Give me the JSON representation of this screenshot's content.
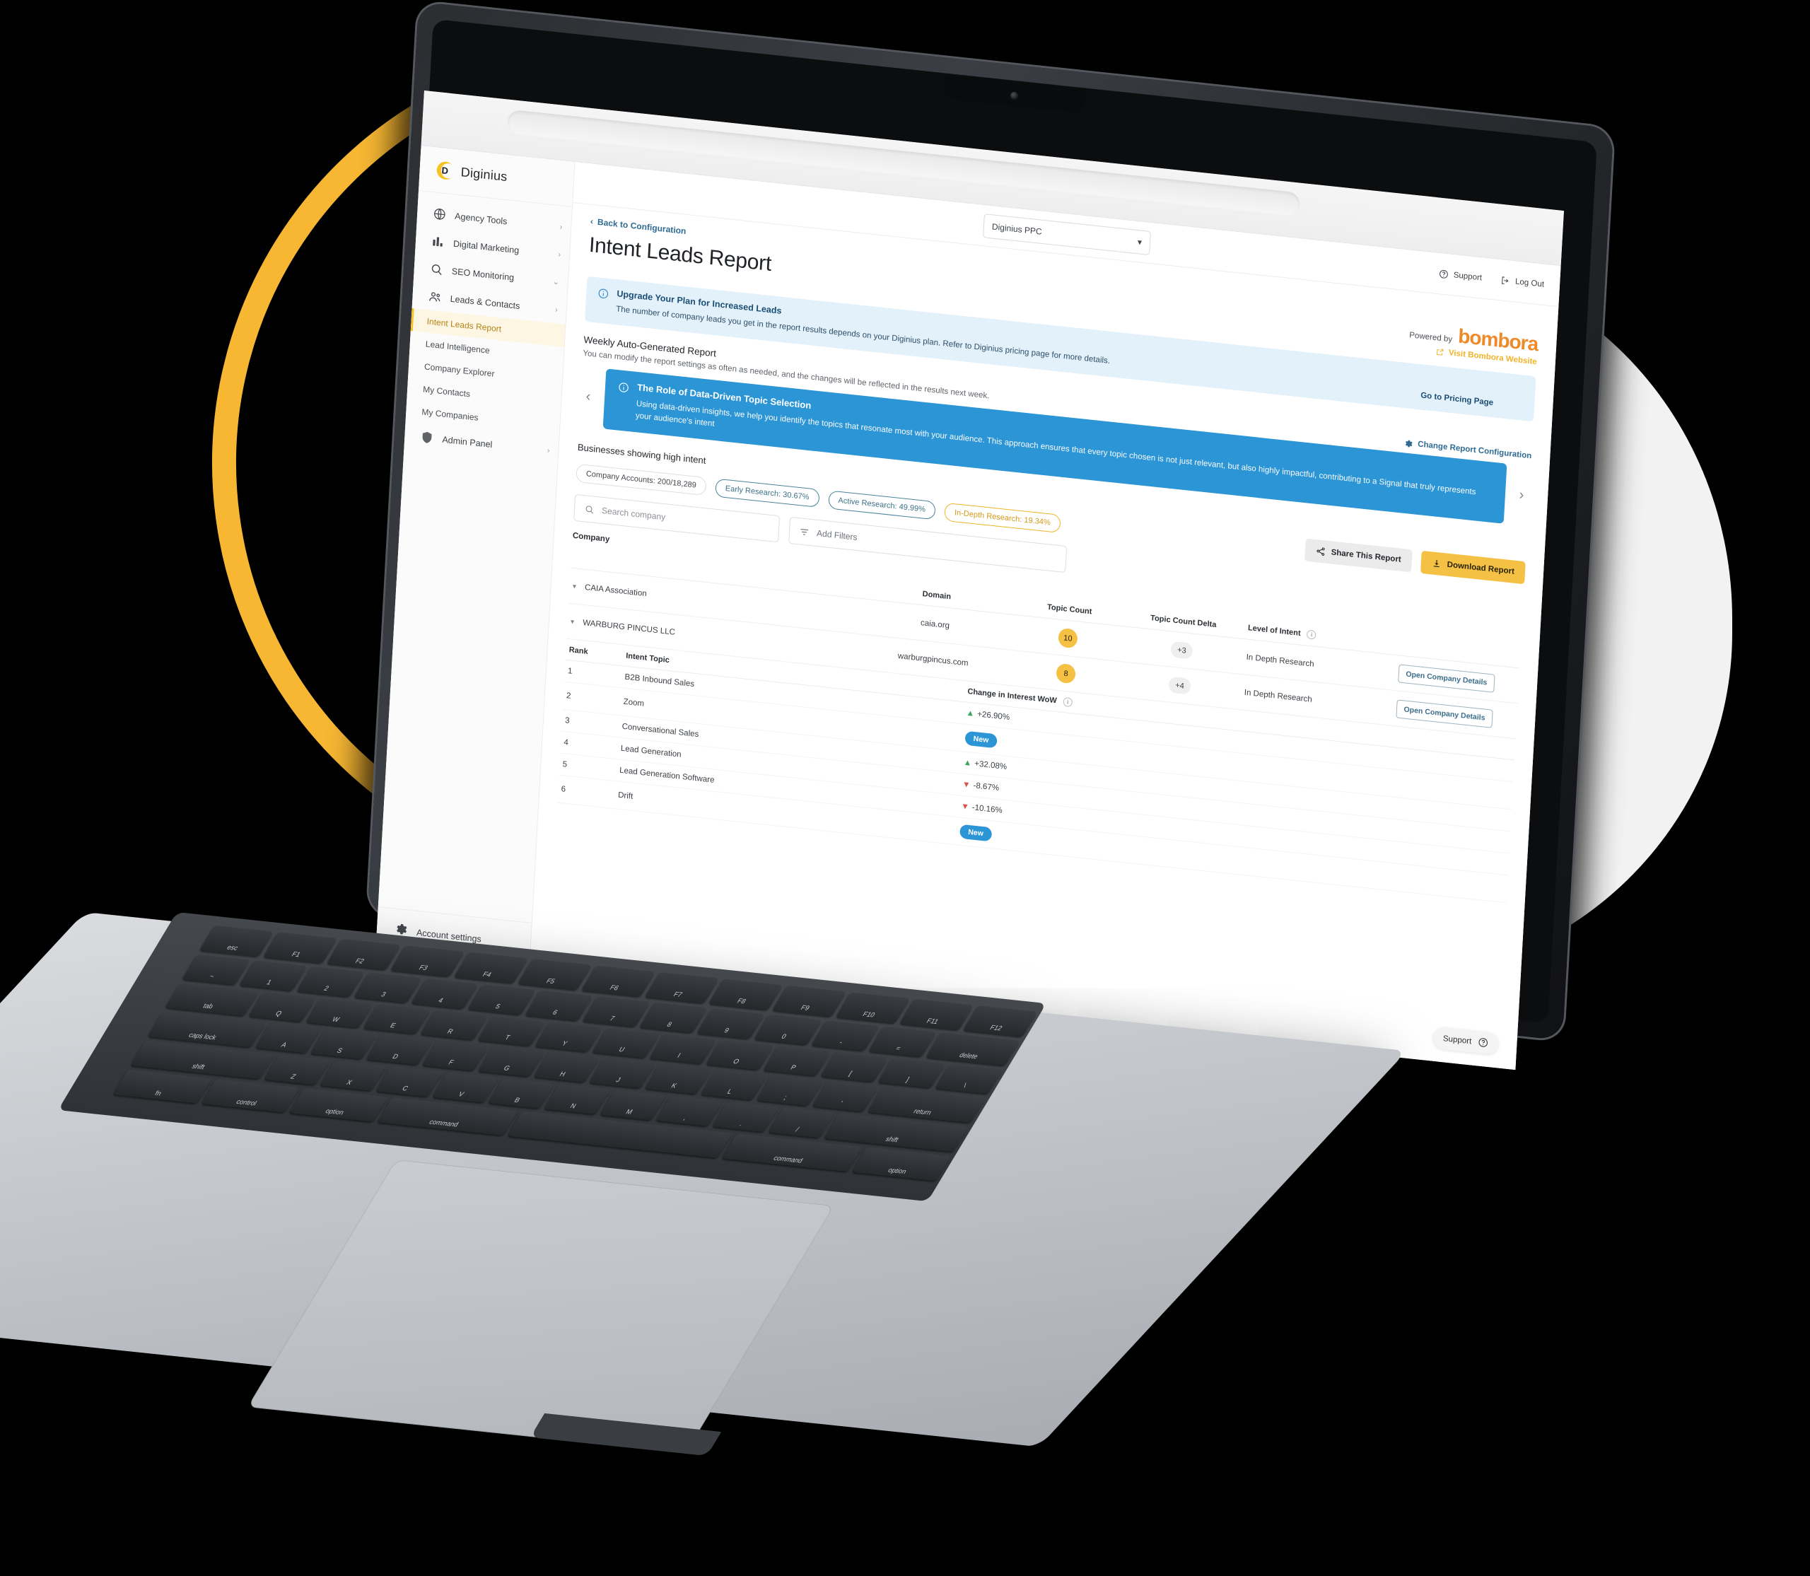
{
  "brand": {
    "name": "Diginius",
    "mark": "D"
  },
  "sidebar": {
    "groups": [
      {
        "label": "Agency Tools",
        "icon": "globe-icon",
        "chevron": "›"
      },
      {
        "label": "Digital Marketing",
        "icon": "bar-chart-icon",
        "chevron": "›"
      },
      {
        "label": "SEO Monitoring",
        "icon": "search-icon",
        "chevron": "⌄"
      },
      {
        "label": "Leads & Contacts",
        "icon": "people-icon",
        "chevron": "›"
      }
    ],
    "sub_items": [
      {
        "label": "Intent Leads Report",
        "active": true
      },
      {
        "label": "Lead Intelligence",
        "active": false
      },
      {
        "label": "Company Explorer",
        "active": false
      },
      {
        "label": "My Contacts",
        "active": false
      },
      {
        "label": "My Companies",
        "active": false
      }
    ],
    "admin": {
      "label": "Admin Panel",
      "icon": "shield-icon",
      "chevron": "›"
    },
    "footer": {
      "label": "Account settings",
      "icon": "gear-icon"
    }
  },
  "topbar": {
    "account_select": "Diginius PPC",
    "select_caret": "▾",
    "support": "Support",
    "logout": "Log Out"
  },
  "page": {
    "breadcrumb": "Back to Configuration",
    "breadcrumb_caret": "‹",
    "title": "Intent Leads Report",
    "powered_by": "Powered by",
    "partner": "bombora",
    "visit_link": "Visit Bombora Website"
  },
  "upgrade_banner": {
    "title": "Upgrade Your Plan for Increased Leads",
    "body": "The number of company leads you get in the report results depends on your Diginius plan. Refer to Diginius pricing page for more details.",
    "cta": "Go to Pricing Page"
  },
  "report_section": {
    "title": "Weekly Auto-Generated Report",
    "subtitle": "You can modify the report settings as often as needed, and the changes will be reflected in the results next week.",
    "config_link": "Change Report Configuration",
    "prev_arrow": "‹",
    "next_arrow": "›"
  },
  "info_card": {
    "title": "The Role of Data-Driven Topic Selection",
    "body": "Using data-driven insights, we help you identify the topics that resonate most with your audience. This approach ensures that every topic chosen is not just relevant, but also highly impactful, contributing to a Signal that truly represents your audience's intent"
  },
  "results": {
    "heading": "Businesses showing high intent",
    "chips": [
      {
        "label": "Company Accounts: 200/18,289",
        "style": "plain"
      },
      {
        "label": "Early Research: 30.67%",
        "style": "teal"
      },
      {
        "label": "Active Research: 49.99%",
        "style": "teal2"
      },
      {
        "label": "In-Depth Research: 19.34%",
        "style": "gold"
      }
    ],
    "share_button": "Share This Report",
    "download_button": "Download Report",
    "search_placeholder": "Search company",
    "add_filters": "Add Filters",
    "company_label": "Company"
  },
  "table": {
    "columns": [
      "Domain",
      "Topic Count",
      "Topic Count Delta",
      "Level of Intent"
    ],
    "rows": [
      {
        "company": "CAIA Association",
        "domain": "caia.org",
        "topic_count": "10",
        "topic_count_delta": "+3",
        "level_of_intent": "In Depth Research",
        "details_button": "Open Company Details"
      },
      {
        "company": "WARBURG PINCUS LLC",
        "domain": "warburgpincus.com",
        "topic_count": "8",
        "topic_count_delta": "+4",
        "level_of_intent": "In Depth Research",
        "details_button": "Open Company Details"
      }
    ]
  },
  "topics_table": {
    "columns": [
      "Rank",
      "Intent Topic",
      "Change in Interest WoW"
    ],
    "rows": [
      {
        "rank": "1",
        "topic": "B2B Inbound Sales",
        "change": "+26.90%",
        "direction": "up",
        "badge": ""
      },
      {
        "rank": "2",
        "topic": "Zoom",
        "change": "",
        "direction": "none",
        "badge": "New"
      },
      {
        "rank": "3",
        "topic": "Conversational Sales",
        "change": "+32.08%",
        "direction": "up",
        "badge": ""
      },
      {
        "rank": "4",
        "topic": "Lead Generation",
        "change": "-8.67%",
        "direction": "down",
        "badge": ""
      },
      {
        "rank": "5",
        "topic": "Lead Generation Software",
        "change": "-10.16%",
        "direction": "down",
        "badge": ""
      },
      {
        "rank": "6",
        "topic": "Drift",
        "change": "",
        "direction": "none",
        "badge": "New"
      }
    ]
  },
  "support_fab": {
    "label": "Support",
    "icon": "question-circle-icon"
  },
  "colors": {
    "brand_yellow": "#F7C324",
    "accent_blue": "#2C95D6",
    "partner_orange": "#ED8B2B",
    "up_green": "#36A65A",
    "down_red": "#D9534F",
    "banner_blue_bg": "#E3F1FB"
  },
  "keyboard": {
    "row1": [
      "esc",
      "F1",
      "F2",
      "F3",
      "F4",
      "F5",
      "F6",
      "F7",
      "F8",
      "F9",
      "F10",
      "F11",
      "F12"
    ],
    "row2": [
      "~",
      "1",
      "2",
      "3",
      "4",
      "5",
      "6",
      "7",
      "8",
      "9",
      "0",
      "-",
      "=",
      "delete"
    ],
    "row3": [
      "tab",
      "Q",
      "W",
      "E",
      "R",
      "T",
      "Y",
      "U",
      "I",
      "O",
      "P",
      "[",
      "]",
      "\\"
    ],
    "row4": [
      "caps lock",
      "A",
      "S",
      "D",
      "F",
      "G",
      "H",
      "J",
      "K",
      "L",
      ";",
      "'",
      "return"
    ],
    "row5": [
      "shift",
      "Z",
      "X",
      "C",
      "V",
      "B",
      "N",
      "M",
      ",",
      ".",
      "/",
      "shift"
    ],
    "row6": [
      "fn",
      "control",
      "option",
      "command",
      "",
      "command",
      "option"
    ]
  }
}
